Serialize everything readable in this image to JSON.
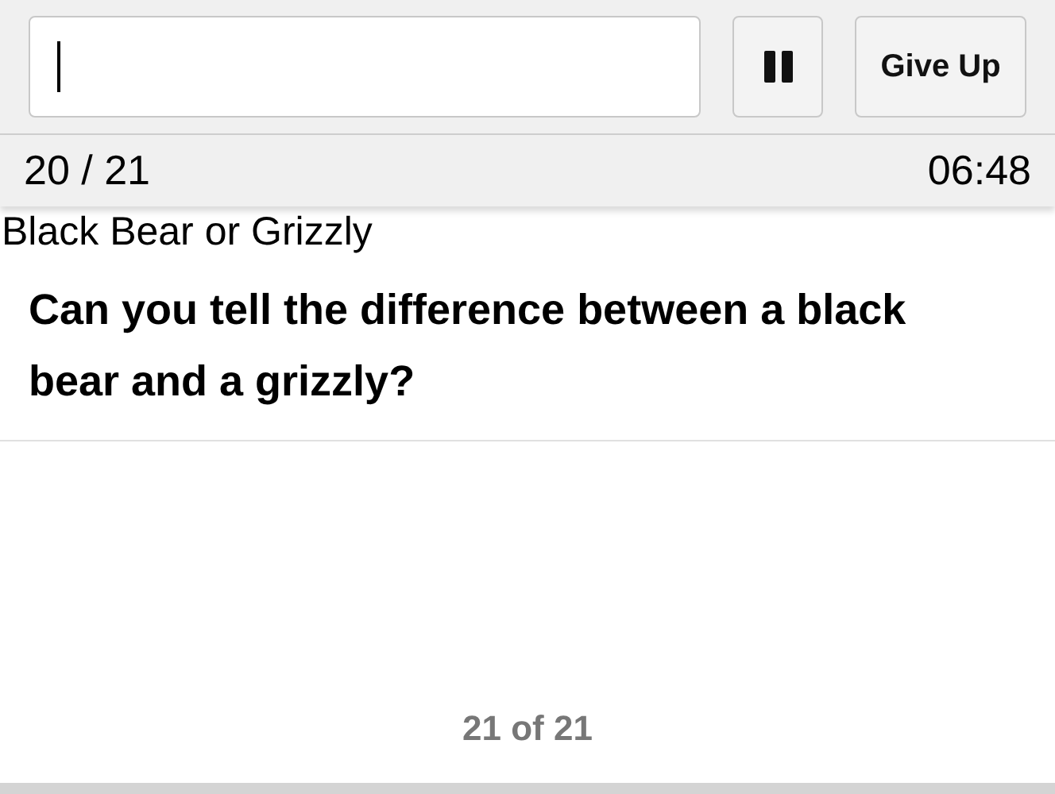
{
  "answer_field": {
    "focused": true
  },
  "buttons": {
    "pause": {
      "kind": "pause"
    },
    "give_up": {
      "label": "Give Up"
    }
  },
  "status_bar": {
    "progress": "20 / 21",
    "timer": "06:48"
  },
  "quiz": {
    "title": "Black Bear or Grizzly",
    "question": "Can you tell the difference between a black bear and a grizzly?"
  },
  "footer": {
    "counter": "21 of 21"
  }
}
